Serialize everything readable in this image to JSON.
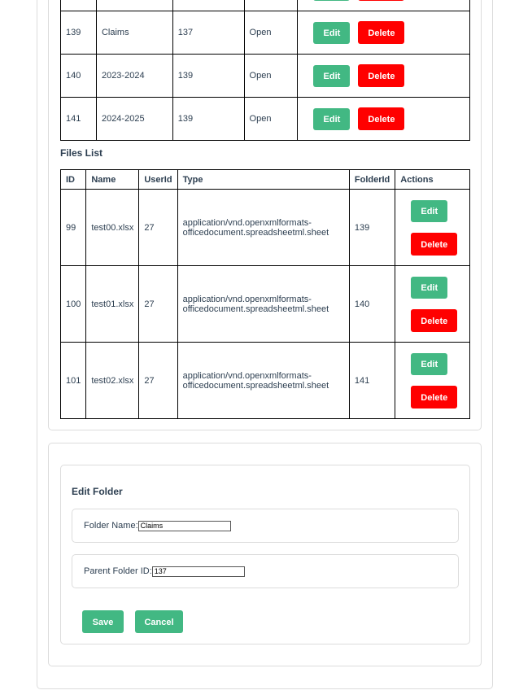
{
  "folders": {
    "rows": [
      {
        "id": "",
        "name": "",
        "parent": "",
        "status": ""
      },
      {
        "id": "139",
        "name": "Claims",
        "parent": "137",
        "status": "Open"
      },
      {
        "id": "140",
        "name": "2023-2024",
        "parent": "139",
        "status": "Open"
      },
      {
        "id": "141",
        "name": "2024-2025",
        "parent": "139",
        "status": "Open"
      }
    ],
    "edit_label": "Edit",
    "delete_label": "Delete"
  },
  "files": {
    "title": "Files List",
    "headers": {
      "id": "ID",
      "name": "Name",
      "userid": "UserId",
      "type": "Type",
      "folderid": "FolderId",
      "actions": "Actions"
    },
    "rows": [
      {
        "id": "99",
        "name": "test00.xlsx",
        "userid": "27",
        "type": "application/vnd.openxmlformats-officedocument.spreadsheetml.sheet",
        "folderid": "139"
      },
      {
        "id": "100",
        "name": "test01.xlsx",
        "userid": "27",
        "type": "application/vnd.openxmlformats-officedocument.spreadsheetml.sheet",
        "folderid": "140"
      },
      {
        "id": "101",
        "name": "test02.xlsx",
        "userid": "27",
        "type": "application/vnd.openxmlformats-officedocument.spreadsheetml.sheet",
        "folderid": "141"
      }
    ],
    "edit_label": "Edit",
    "delete_label": "Delete"
  },
  "edit_folder": {
    "title": "Edit Folder",
    "folder_name_label": "Folder Name:",
    "folder_name_value": "Claims",
    "parent_id_label": "Parent Folder ID:",
    "parent_id_value": "137",
    "save_label": "Save",
    "cancel_label": "Cancel"
  },
  "colors": {
    "accent": "#42b883",
    "danger": "#ff0000",
    "text": "#2c3e50"
  }
}
